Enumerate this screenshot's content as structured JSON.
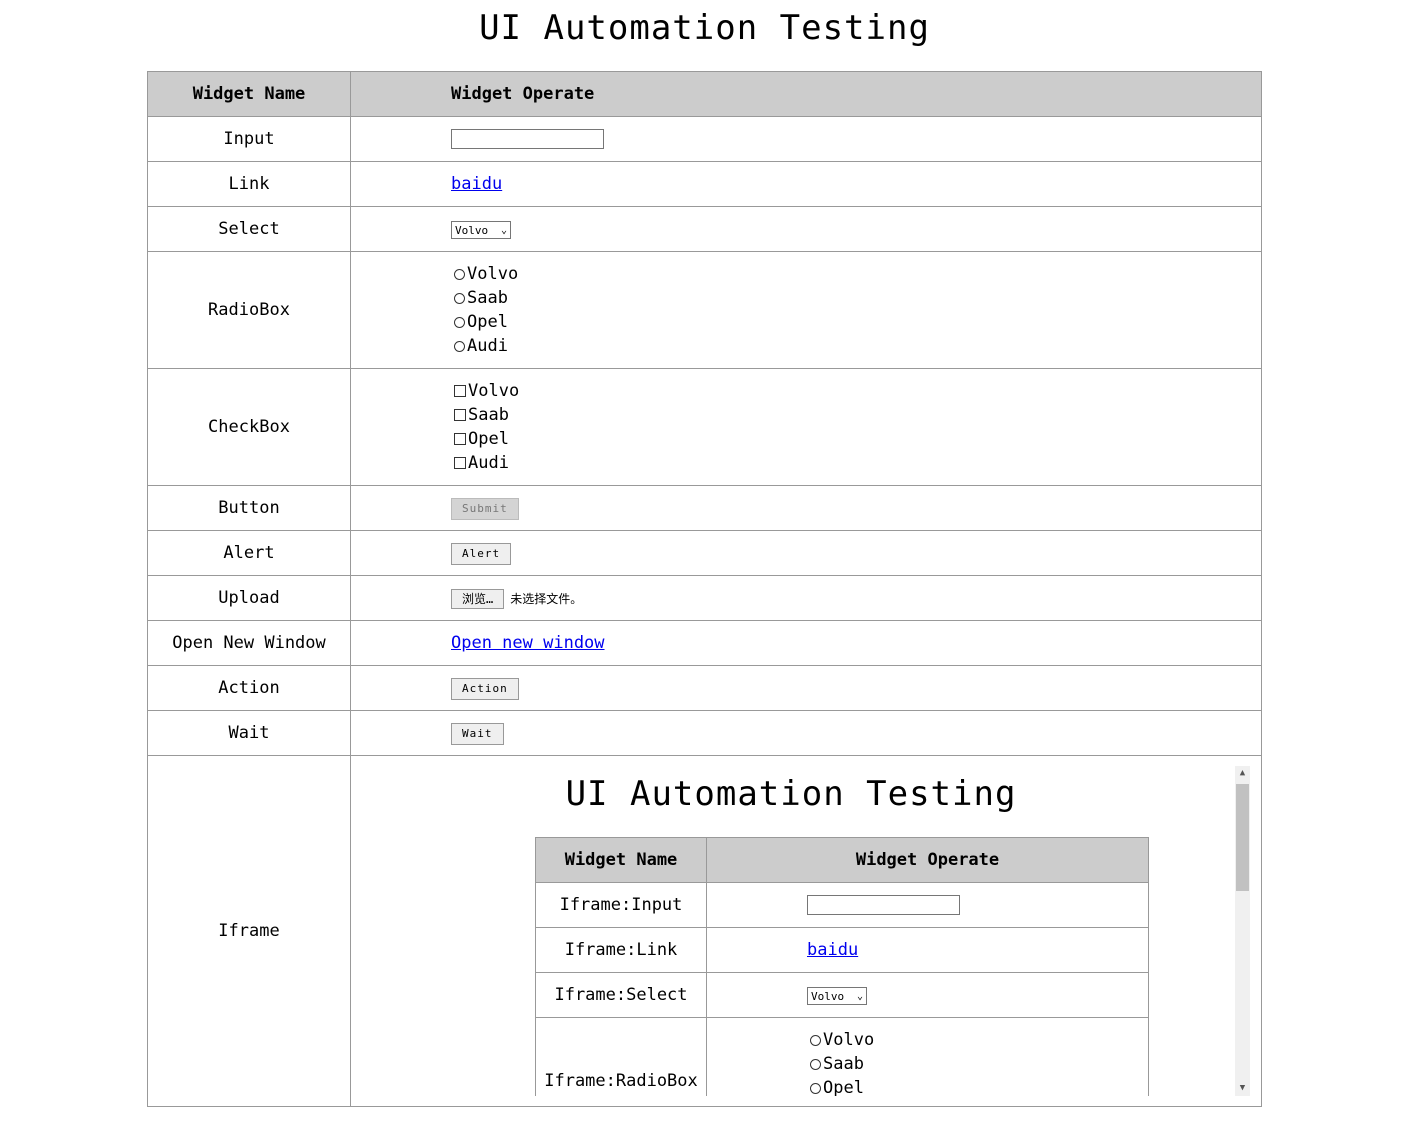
{
  "page": {
    "title": "UI Automation Testing"
  },
  "table": {
    "headers": {
      "name": "Widget Name",
      "operate": "Widget Operate"
    },
    "rows": {
      "input": {
        "name": "Input",
        "value": ""
      },
      "link": {
        "name": "Link",
        "text": "baidu"
      },
      "select": {
        "name": "Select",
        "value": "Volvo"
      },
      "radio": {
        "name": "RadioBox",
        "options": [
          "Volvo",
          "Saab",
          "Opel",
          "Audi"
        ]
      },
      "checkbox": {
        "name": "CheckBox",
        "options": [
          "Volvo",
          "Saab",
          "Opel",
          "Audi"
        ]
      },
      "button": {
        "name": "Button",
        "label": "Submit"
      },
      "alert": {
        "name": "Alert",
        "label": "Alert"
      },
      "upload": {
        "name": "Upload",
        "button": "浏览…",
        "status": "未选择文件。"
      },
      "newwindow": {
        "name": "Open New Window",
        "text": "Open new window"
      },
      "action": {
        "name": "Action",
        "label": "Action"
      },
      "wait": {
        "name": "Wait",
        "label": "Wait"
      },
      "iframe": {
        "name": "Iframe"
      }
    }
  },
  "iframe": {
    "title": "UI Automation Testing",
    "headers": {
      "name": "Widget Name",
      "operate": "Widget Operate"
    },
    "rows": {
      "input": {
        "name": "Iframe:Input",
        "value": ""
      },
      "link": {
        "name": "Iframe:Link",
        "text": "baidu"
      },
      "select": {
        "name": "Iframe:Select",
        "value": "Volvo"
      },
      "radio": {
        "name": "Iframe:RadioBox",
        "options": [
          "Volvo",
          "Saab",
          "Opel"
        ]
      }
    },
    "scroll": {
      "up": "▲",
      "down": "▼"
    }
  },
  "icons": {
    "select_chevron": "chevron-down-icon"
  }
}
